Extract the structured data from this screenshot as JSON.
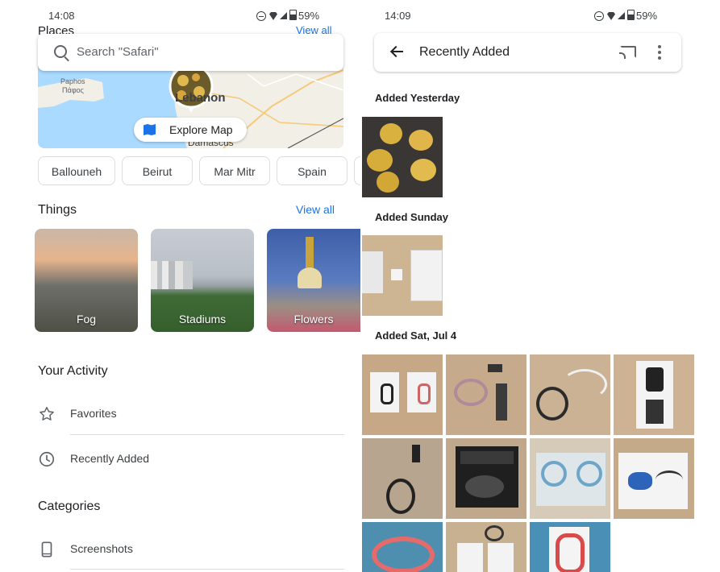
{
  "left": {
    "status": {
      "time": "14:08",
      "battery": "59%"
    },
    "search": {
      "placeholder": "Search \"Safari\""
    },
    "places": {
      "title_peek": "Places",
      "view_all": "View all"
    },
    "map": {
      "labels": [
        "Paphos",
        "Πάφος",
        "Lebanon",
        "Damascus"
      ],
      "explore": "Explore Map"
    },
    "chips": [
      "Ballouneh",
      "Beirut",
      "Mar Mitr",
      "Spain"
    ],
    "things": {
      "title": "Things",
      "view_all": "View all",
      "items": [
        "Fog",
        "Stadiums",
        "Flowers"
      ]
    },
    "activity": {
      "title": "Your Activity",
      "items": [
        {
          "label": "Favorites",
          "icon": "star-icon"
        },
        {
          "label": "Recently Added",
          "icon": "clock-icon"
        }
      ]
    },
    "categories": {
      "title": "Categories",
      "items": [
        {
          "label": "Screenshots",
          "icon": "phone-icon"
        }
      ]
    }
  },
  "right": {
    "status": {
      "time": "14:09",
      "battery": "59%"
    },
    "appbar": {
      "title": "Recently Added",
      "icons": [
        "back-arrow-icon",
        "cast-icon",
        "more-vert-icon"
      ]
    },
    "groups": [
      {
        "label": "Added Yesterday",
        "count": 1
      },
      {
        "label": "Added Sunday",
        "count": 1
      },
      {
        "label": "Added Sat, Jul 4",
        "count": 11
      }
    ]
  },
  "colors": {
    "accent": "#1a73e8",
    "text": "#202124",
    "divider": "#dadce0"
  }
}
